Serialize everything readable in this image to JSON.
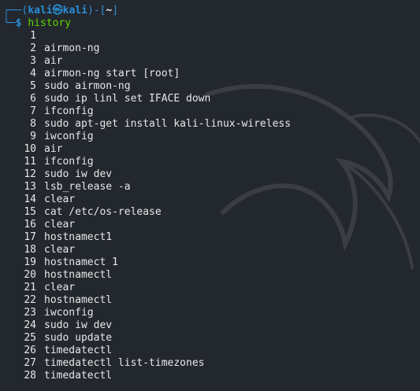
{
  "prompt": {
    "corner_top": "┌──(",
    "user_host": "kali㉿kali",
    "sep": ")-[",
    "dir": "~",
    "close": "]",
    "corner_bottom": "└─",
    "dollar": "$",
    "command": "history"
  },
  "history": [
    {
      "num": "1",
      "cmd": ""
    },
    {
      "num": "2",
      "cmd": "airmon-ng"
    },
    {
      "num": "3",
      "cmd": "air"
    },
    {
      "num": "4",
      "cmd": "airmon-ng start [root]"
    },
    {
      "num": "5",
      "cmd": "sudo airmon-ng"
    },
    {
      "num": "6",
      "cmd": "sudo ip linl set IFACE down"
    },
    {
      "num": "7",
      "cmd": "ifconfig"
    },
    {
      "num": "8",
      "cmd": "sudo apt-get install kali-linux-wireless"
    },
    {
      "num": "9",
      "cmd": "iwconfig"
    },
    {
      "num": "10",
      "cmd": "air"
    },
    {
      "num": "11",
      "cmd": "ifconfig"
    },
    {
      "num": "12",
      "cmd": "sudo iw dev"
    },
    {
      "num": "13",
      "cmd": "lsb_release -a"
    },
    {
      "num": "14",
      "cmd": "clear"
    },
    {
      "num": "15",
      "cmd": "cat /etc/os-release"
    },
    {
      "num": "16",
      "cmd": "clear"
    },
    {
      "num": "17",
      "cmd": "hostnamect1"
    },
    {
      "num": "18",
      "cmd": "clear"
    },
    {
      "num": "19",
      "cmd": "hostnamect 1"
    },
    {
      "num": "20",
      "cmd": "hostnamectl"
    },
    {
      "num": "21",
      "cmd": "clear"
    },
    {
      "num": "22",
      "cmd": "hostnamectl"
    },
    {
      "num": "23",
      "cmd": "iwconfig"
    },
    {
      "num": "24",
      "cmd": "sudo iw dev"
    },
    {
      "num": "25",
      "cmd": "sudo update"
    },
    {
      "num": "26",
      "cmd": "timedatectl"
    },
    {
      "num": "27",
      "cmd": "timedatectl list-timezones"
    },
    {
      "num": "28",
      "cmd": "timedatectl"
    }
  ],
  "colors": {
    "background": "#23272e",
    "prompt_blue": "#2a8fd6",
    "command_green": "#5fd700",
    "text": "#e8e8e8"
  },
  "icons": {
    "watermark": "kali-dragon-watermark-icon"
  }
}
